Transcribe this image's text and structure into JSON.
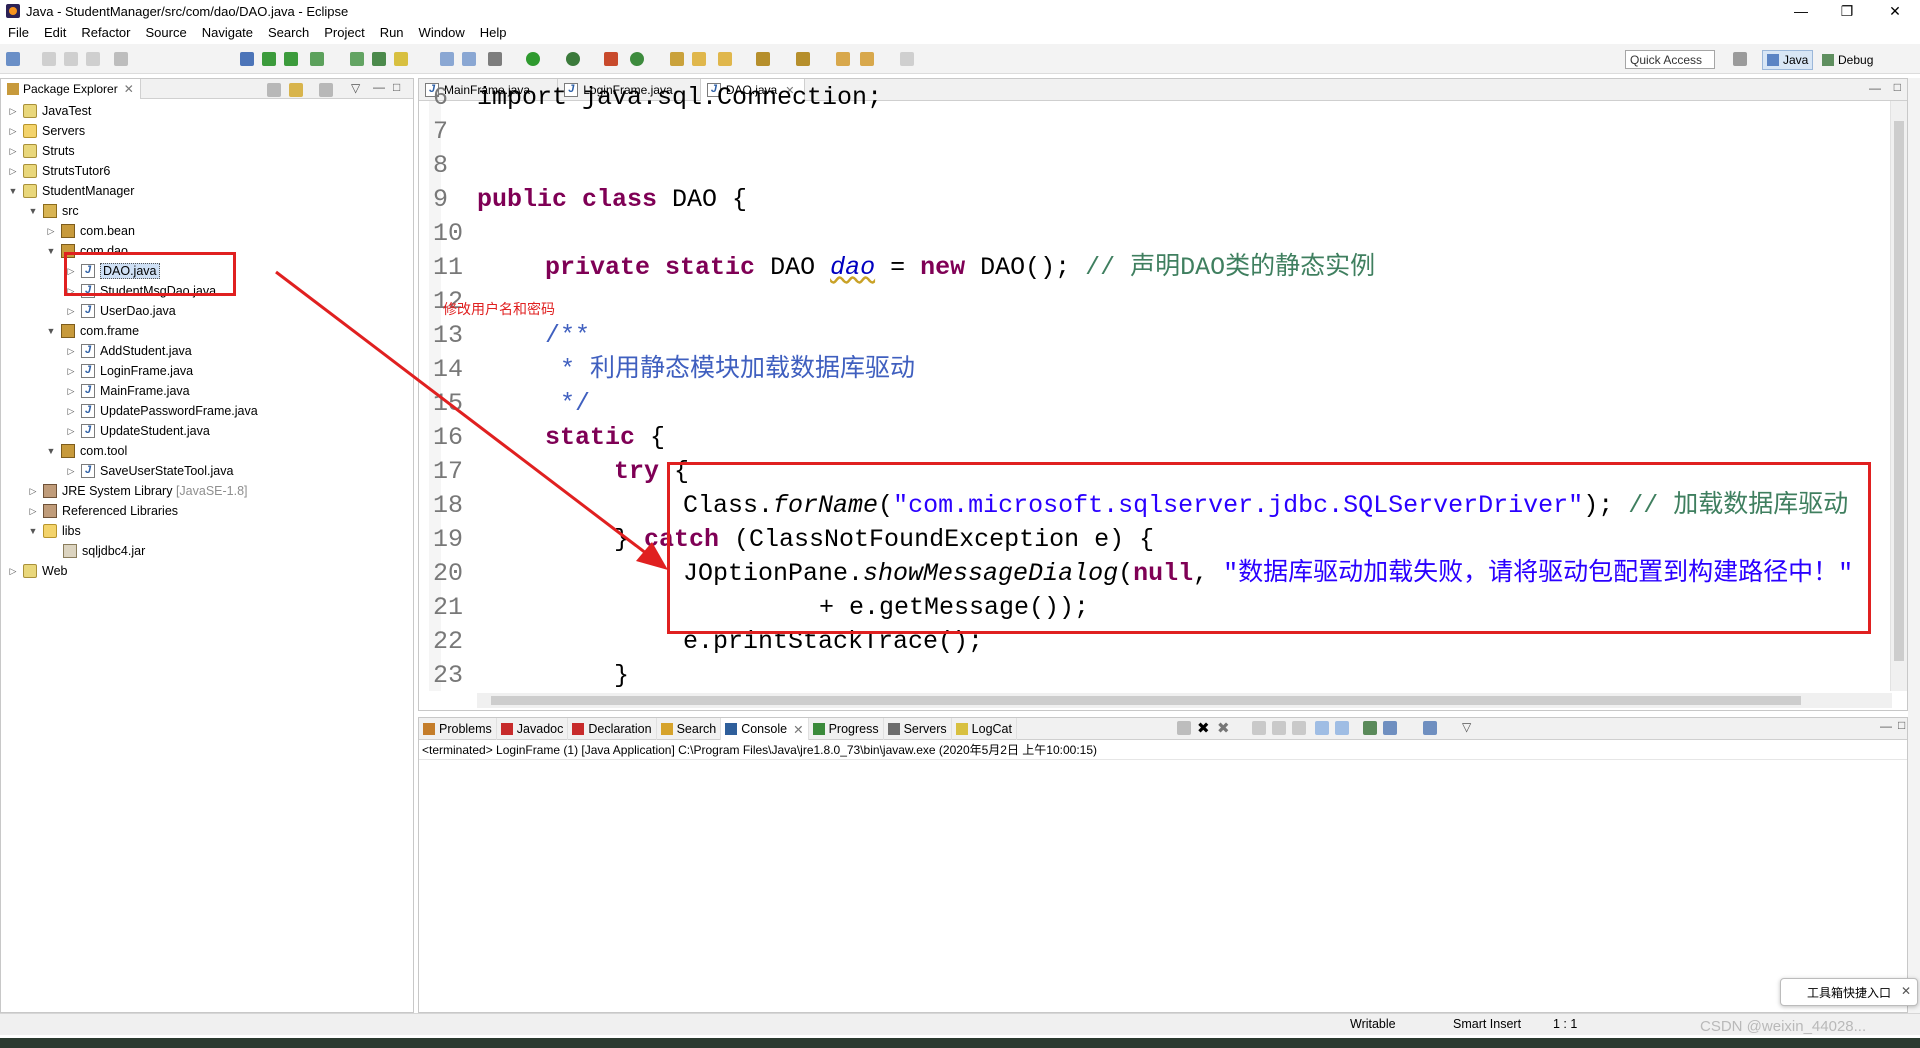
{
  "window": {
    "title": "Java - StudentManager/src/com/dao/DAO.java - Eclipse",
    "minimize_icon": "minimize-icon",
    "restore_icon": "restore-icon",
    "close_icon": "close-icon"
  },
  "menu": [
    "File",
    "Edit",
    "Refactor",
    "Source",
    "Navigate",
    "Search",
    "Project",
    "Run",
    "Window",
    "Help"
  ],
  "toolbar": {
    "quick_access": "Quick Access",
    "perspectives": [
      "Java",
      "Debug"
    ]
  },
  "package_explorer": {
    "title": "Package Explorer",
    "items": [
      {
        "label": "JavaTest"
      },
      {
        "label": "Servers"
      },
      {
        "label": "Struts"
      },
      {
        "label": "StrutsTutor6"
      },
      {
        "label": "StudentManager"
      },
      {
        "label": "src"
      },
      {
        "label": "com.bean"
      },
      {
        "label": "com.dao"
      },
      {
        "label": "DAO.java"
      },
      {
        "label": "StudentMsgDao.java"
      },
      {
        "label": "UserDao.java"
      },
      {
        "label": "com.frame"
      },
      {
        "label": "AddStudent.java"
      },
      {
        "label": "LoginFrame.java"
      },
      {
        "label": "MainFrame.java"
      },
      {
        "label": "UpdatePasswordFrame.java"
      },
      {
        "label": "UpdateStudent.java"
      },
      {
        "label": "com.tool"
      },
      {
        "label": "SaveUserStateTool.java"
      },
      {
        "label": "JRE System Library",
        "suffix": "[JavaSE-1.8]"
      },
      {
        "label": "Referenced Libraries"
      },
      {
        "label": "libs"
      },
      {
        "label": "sqljdbc4.jar"
      },
      {
        "label": "Web"
      }
    ]
  },
  "editor": {
    "tabs": [
      "MainFrame.java",
      "LoginFrame.java",
      "DAO.java"
    ],
    "active_tab": "DAO.java",
    "line_numbers": [
      "6",
      "7",
      "8",
      "9",
      "10",
      "11",
      "12",
      "13",
      "14",
      "15",
      "16",
      "17",
      "18",
      "19",
      "20",
      "21",
      "22",
      "23"
    ],
    "code": {
      "l6": "import java.sql.Connection;",
      "l9_kw1": "public",
      "l9_kw2": "class",
      "l9_rest": " DAO {",
      "l11_kw1": "private",
      "l11_kw2": "static",
      "l11_type": " DAO ",
      "l11_field": "dao",
      "l11_eq": " = ",
      "l11_new": "new",
      "l11_ctor": " DAO(); ",
      "l11_comment": "// 声明DAO类的静态实例",
      "l13": "/**",
      "l14": " * 利用静态模块加载数据库驱动",
      "l15": " */",
      "l16_kw": "static",
      "l16_rest": " {",
      "l17_kw": "try",
      "l17_rest": " {",
      "l18_a": "Class.",
      "l18_m": "forName",
      "l18_b": "(",
      "l18_s": "\"com.microsoft.sqlserver.jdbc.SQLServerDriver\"",
      "l18_c": "); ",
      "l18_comment": "// 加载数据库驱动",
      "l19_a": "} ",
      "l19_kw": "catch",
      "l19_b": " (ClassNotFoundException e) {",
      "l20_a": "JOptionPane.",
      "l20_m": "showMessageDialog",
      "l20_b": "(",
      "l20_kw": "null",
      "l20_c": ", ",
      "l20_s": "\"数据库驱动加载失败，请将驱动包配置到构建路径中！\"",
      "l21": "+ e.getMessage());",
      "l22": "e.printStackTrace();",
      "l23": "}"
    }
  },
  "annotation": {
    "note": "修改用户名和密码"
  },
  "console": {
    "tabs": [
      "Problems",
      "Javadoc",
      "Declaration",
      "Search",
      "Console",
      "Progress",
      "Servers",
      "LogCat"
    ],
    "active_tab": "Console",
    "description": "<terminated> LoginFrame (1) [Java Application] C:\\Program Files\\Java\\jre1.8.0_73\\bin\\javaw.exe (2020年5月2日 上午10:00:15)"
  },
  "status": {
    "writable": "Writable",
    "insert_mode": "Smart Insert",
    "position": "1 : 1"
  },
  "popup": {
    "label": "工具箱快捷入口"
  },
  "watermark": "CSDN @weixin_44028..."
}
